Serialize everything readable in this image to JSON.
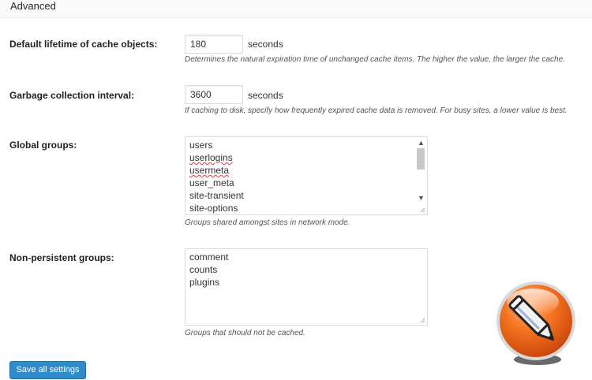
{
  "section": {
    "title": "Advanced"
  },
  "fields": {
    "lifetime": {
      "label": "Default lifetime of cache objects:",
      "value": "180",
      "unit": "seconds",
      "description": "Determines the natural expiration time of unchanged cache items. The higher the value, the larger the cache."
    },
    "gc": {
      "label": "Garbage collection interval:",
      "value": "3600",
      "unit": "seconds",
      "description": "If caching to disk, specify how frequently expired cache data is removed. For busy sites, a lower value is best."
    },
    "global_groups": {
      "label": "Global groups:",
      "lines": [
        "users",
        "userlogins",
        "usermeta",
        "user_meta",
        "site-transient",
        "site-options"
      ],
      "description": "Groups shared amongst sites in network mode."
    },
    "non_persistent": {
      "label": "Non-persistent groups:",
      "lines": [
        "comment",
        "counts",
        "plugins"
      ],
      "description": "Groups that should not be cached."
    }
  },
  "save_button": {
    "label": "Save all settings"
  },
  "colors": {
    "button": "#2e8ccb",
    "badge": "#f26a1b"
  },
  "icons": {
    "badge": "pencil-icon"
  }
}
